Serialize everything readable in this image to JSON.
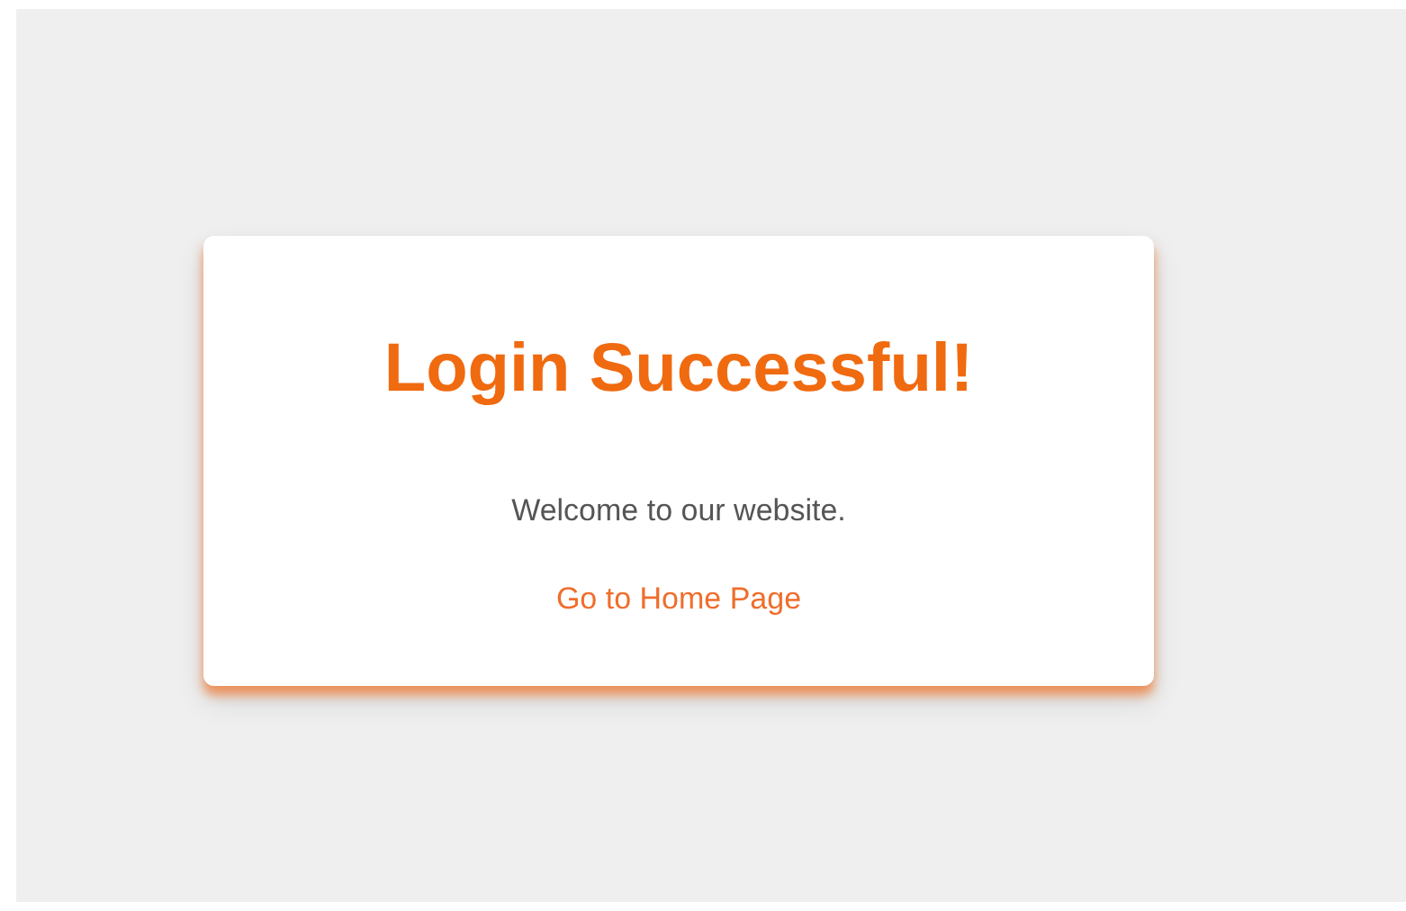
{
  "card": {
    "title": "Login Successful!",
    "message": "Welcome to our website.",
    "link": "Go to Home Page"
  }
}
